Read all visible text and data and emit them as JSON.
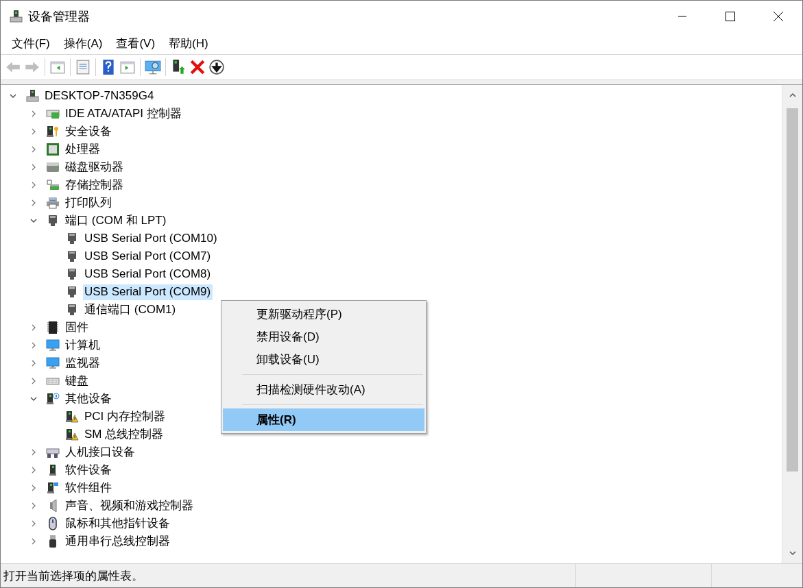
{
  "window": {
    "title": "设备管理器"
  },
  "menu_bar": [
    {
      "label": "文件(F)"
    },
    {
      "label": "操作(A)"
    },
    {
      "label": "查看(V)"
    },
    {
      "label": "帮助(H)"
    }
  ],
  "toolbar": [
    {
      "disabled": true
    },
    {
      "disabled": true
    },
    {
      "disabled": false
    },
    {
      "disabled": false
    },
    {
      "disabled": false
    },
    {
      "disabled": false
    },
    {
      "disabled": false
    },
    {
      "disabled": false
    },
    {
      "disabled": false
    },
    {
      "disabled": false
    }
  ],
  "tree": [
    {
      "label": "DESKTOP-7N359G4",
      "expanded": true,
      "selected": false,
      "children": [
        {
          "label": "IDE ATA/ATAPI 控制器",
          "expanded": false,
          "selected": false
        },
        {
          "label": "安全设备",
          "expanded": false,
          "selected": false
        },
        {
          "label": "处理器",
          "expanded": false,
          "selected": false
        },
        {
          "label": "磁盘驱动器",
          "expanded": false,
          "selected": false
        },
        {
          "label": "存储控制器",
          "expanded": false,
          "selected": false
        },
        {
          "label": "打印队列",
          "expanded": false,
          "selected": false
        },
        {
          "label": "端口 (COM 和 LPT)",
          "expanded": true,
          "selected": false,
          "children": [
            {
              "label": "USB Serial Port (COM10)",
              "selected": false
            },
            {
              "label": "USB Serial Port (COM7)",
              "selected": false
            },
            {
              "label": "USB Serial Port (COM8)",
              "selected": false
            },
            {
              "label": "USB Serial Port (COM9)",
              "selected": true
            },
            {
              "label": "通信端口 (COM1)",
              "selected": false
            }
          ]
        },
        {
          "label": "固件",
          "expanded": false,
          "selected": false
        },
        {
          "label": "计算机",
          "expanded": false,
          "selected": false
        },
        {
          "label": "监视器",
          "expanded": false,
          "selected": false
        },
        {
          "label": "键盘",
          "expanded": false,
          "selected": false
        },
        {
          "label": "其他设备",
          "expanded": true,
          "selected": false,
          "children": [
            {
              "label": "PCI 内存控制器",
              "selected": false
            },
            {
              "label": "SM 总线控制器",
              "selected": false
            }
          ]
        },
        {
          "label": "人机接口设备",
          "expanded": false,
          "selected": false
        },
        {
          "label": "软件设备",
          "expanded": false,
          "selected": false
        },
        {
          "label": "软件组件",
          "expanded": false,
          "selected": false
        },
        {
          "label": "声音、视频和游戏控制器",
          "expanded": false,
          "selected": false
        },
        {
          "label": "鼠标和其他指针设备",
          "expanded": false,
          "selected": false
        },
        {
          "label": "通用串行总线控制器",
          "expanded": false,
          "selected": false
        }
      ]
    }
  ],
  "context_menu": [
    {
      "kind": "item",
      "label": "更新驱动程序(P)",
      "default": false,
      "selected": false
    },
    {
      "kind": "item",
      "label": "禁用设备(D)",
      "default": false,
      "selected": false
    },
    {
      "kind": "item",
      "label": "卸载设备(U)",
      "default": false,
      "selected": false
    },
    {
      "kind": "separator"
    },
    {
      "kind": "item",
      "label": "扫描检测硬件改动(A)",
      "default": false,
      "selected": false
    },
    {
      "kind": "separator"
    },
    {
      "kind": "item",
      "label": "属性(R)",
      "default": true,
      "selected": true
    }
  ],
  "status_bar": {
    "text": "打开当前选择项的属性表。"
  }
}
